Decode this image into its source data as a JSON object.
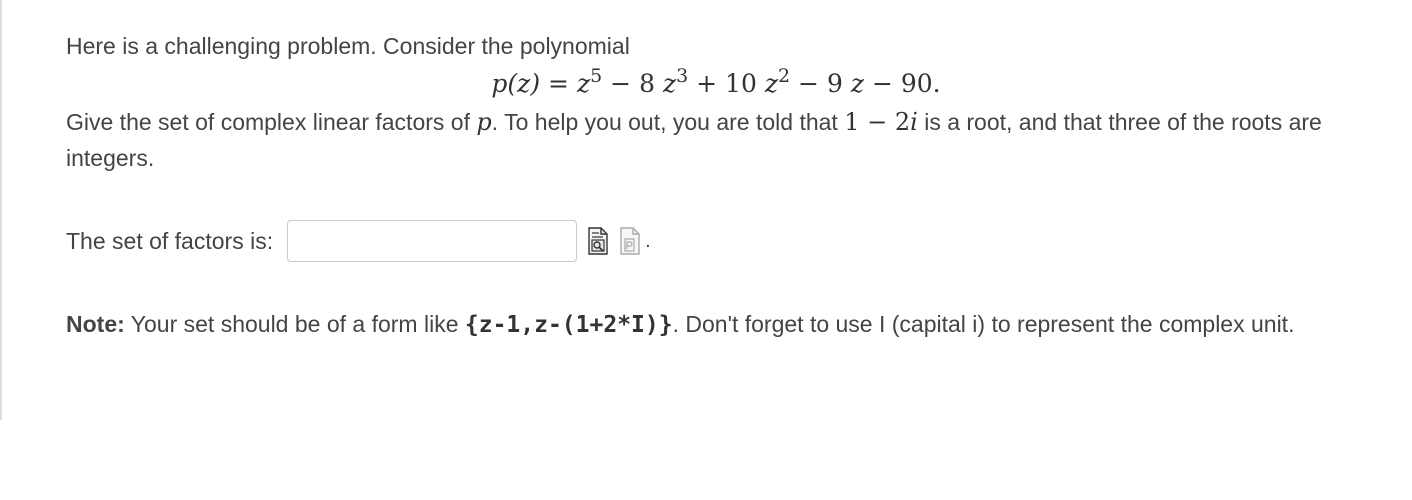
{
  "problem": {
    "intro": "Here is a challenging problem. Consider the polynomial",
    "formula": {
      "lhs": "p(z)",
      "eq": "=",
      "z": "z",
      "exp5": "5",
      "minus8": "− 8",
      "exp3": "3",
      "plus10": "+ 10",
      "exp2": "2",
      "minus9": "− 9",
      "tail": "− 90."
    },
    "question_part1": "Give the set of complex linear factors of ",
    "p_symbol": "p",
    "question_part2": ". To help you out, you are told that ",
    "root_real": "1 − 2",
    "root_i": "i",
    "question_part3": " is a root, and that three of the roots are integers."
  },
  "answer": {
    "label": "The set of factors is:",
    "value": "",
    "placeholder": "",
    "preview_icon": "preview-icon",
    "help_icon": "help-icon",
    "trailing": "."
  },
  "note": {
    "label": "Note:",
    "text1": " Your set should be of a form like ",
    "example": "{z-1,z-(1+2*I)}",
    "text2": ". Don't forget to use I (capital i) to represent the complex unit."
  }
}
